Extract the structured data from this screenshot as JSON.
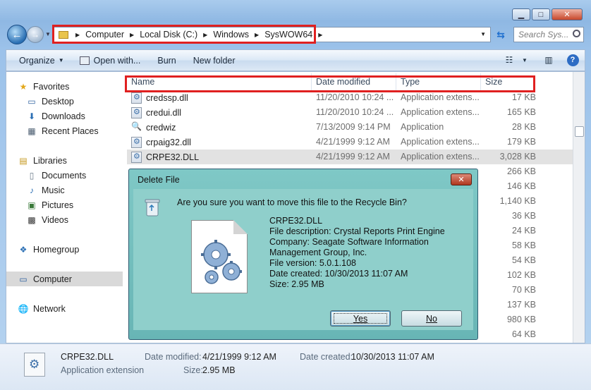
{
  "window": {
    "minimize_glyph": "▁",
    "maximize_glyph": "□",
    "close_glyph": "✕"
  },
  "address": {
    "crumbs": [
      "Computer",
      "Local Disk (C:)",
      "Windows",
      "SysWOW64"
    ],
    "search_placeholder": "Search Sys..."
  },
  "toolbar": {
    "organize": "Organize",
    "open_with": "Open with...",
    "burn": "Burn",
    "new_folder": "New folder"
  },
  "sidebar": {
    "favorites": "Favorites",
    "desktop": "Desktop",
    "downloads": "Downloads",
    "recent": "Recent Places",
    "libraries": "Libraries",
    "documents": "Documents",
    "music": "Music",
    "pictures": "Pictures",
    "videos": "Videos",
    "homegroup": "Homegroup",
    "computer": "Computer",
    "network": "Network"
  },
  "columns": {
    "name": "Name",
    "date": "Date modified",
    "type": "Type",
    "size": "Size"
  },
  "files": [
    {
      "name": "credssp.dll",
      "date": "11/20/2010 10:24 ...",
      "type": "Application extens...",
      "size": "17 KB"
    },
    {
      "name": "credui.dll",
      "date": "11/20/2010 10:24 ...",
      "type": "Application extens...",
      "size": "165 KB"
    },
    {
      "name": "credwiz",
      "date": "7/13/2009 9:14 PM",
      "type": "Application",
      "size": "28 KB"
    },
    {
      "name": "crpaig32.dll",
      "date": "4/21/1999 9:12 AM",
      "type": "Application extens...",
      "size": "179 KB"
    },
    {
      "name": "CRPE32.DLL",
      "date": "4/21/1999 9:12 AM",
      "type": "Application extens...",
      "size": "3,028 KB"
    }
  ],
  "hidden_sizes": [
    "266 KB",
    "146 KB",
    "1,140 KB",
    "36 KB",
    "24 KB",
    "58 KB",
    "54 KB",
    "102 KB",
    "70 KB",
    "137 KB",
    "980 KB",
    "64 KB"
  ],
  "dialog": {
    "title": "Delete File",
    "close_glyph": "✕",
    "question": "Are you sure you want to move this file to the Recycle Bin?",
    "file_name": "CRPE32.DLL",
    "description": "File description: Crystal Reports Print Engine",
    "company_1": "Company: Seagate Software Information",
    "company_2": "Management Group, Inc.",
    "version": "File version: 5.0.1.108",
    "created": "Date created: 10/30/2013 11:07 AM",
    "size": "Size: 2.95 MB",
    "yes": "Yes",
    "no": "No"
  },
  "details": {
    "name": "CRPE32.DLL",
    "type": "Application extension",
    "modified_label": "Date modified:",
    "modified_value": "4/21/1999 9:12 AM",
    "size_label": "Size:",
    "size_value": "2.95 MB",
    "created_label": "Date created:",
    "created_value": "10/30/2013 11:07 AM"
  }
}
